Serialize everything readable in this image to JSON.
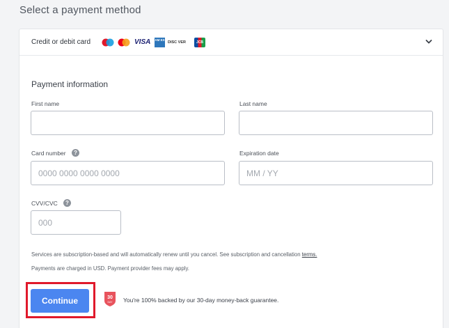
{
  "page": {
    "title": "Select a payment method"
  },
  "method": {
    "label": "Credit or debit card",
    "logos": [
      "maestro-logo",
      "mastercard-logo",
      "visa-logo",
      "amex-logo",
      "discover-logo",
      "jcb-logo"
    ],
    "visa_text": "VISA",
    "amex_text": "AM EX",
    "discover_text": "DISC VER",
    "jcb_text": "JCB"
  },
  "form": {
    "section_title": "Payment information",
    "first_name": {
      "label": "First name",
      "value": "",
      "placeholder": ""
    },
    "last_name": {
      "label": "Last name",
      "value": "",
      "placeholder": ""
    },
    "card_number": {
      "label": "Card number",
      "value": "",
      "placeholder": "0000 0000 0000 0000"
    },
    "expiration": {
      "label": "Expiration date",
      "value": "",
      "placeholder": "MM / YY"
    },
    "cvv": {
      "label": "CVV/CVC",
      "value": "",
      "placeholder": "000"
    }
  },
  "notes": {
    "subscription": "Services are subscription-based and will automatically renew until you cancel. See subscription and cancellation",
    "terms_link": "terms.",
    "currency": "Payments are charged in USD. Payment provider fees may apply."
  },
  "actions": {
    "continue_label": "Continue",
    "badge_number": "30",
    "badge_text": "DAY",
    "guarantee": "You're 100% backed by our 30-day money-back guarantee."
  },
  "colors": {
    "accent": "#4b86f0",
    "highlight": "#e0192b",
    "badge": "#e8535d"
  }
}
